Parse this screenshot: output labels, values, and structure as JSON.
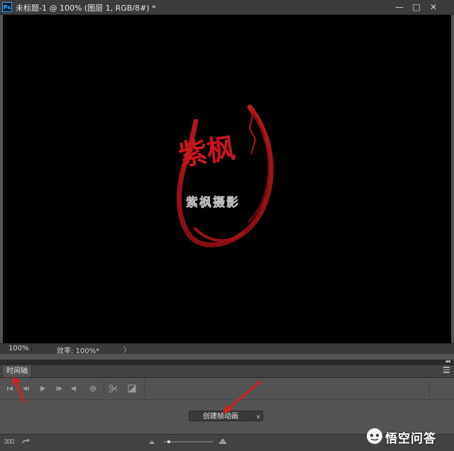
{
  "app": {
    "logo": "Ps"
  },
  "document": {
    "title": "未标题-1 @ 100% (图层 1, RGB/8#) *"
  },
  "window_controls": {
    "minimize": "—",
    "maximize": "□",
    "close": "✕"
  },
  "status": {
    "zoom": "100%",
    "efficiency": "效率: 100%*",
    "arrow": "〉"
  },
  "panel": {
    "collapse": "◂◂",
    "tab_label": "时间轴",
    "create_button": "创建帧动画",
    "dropdown_icon": "∨"
  },
  "logo_art": {
    "calligraphy": "紫枫",
    "subtitle": "紫枫摄影",
    "color": "#b5161e"
  },
  "annotations": {
    "arrow_color": "#d42020"
  },
  "watermark": {
    "text": "悟空问答"
  },
  "colors": {
    "canvas": "#000000",
    "panel": "#535353",
    "titlebar": "#3c3c3c"
  }
}
